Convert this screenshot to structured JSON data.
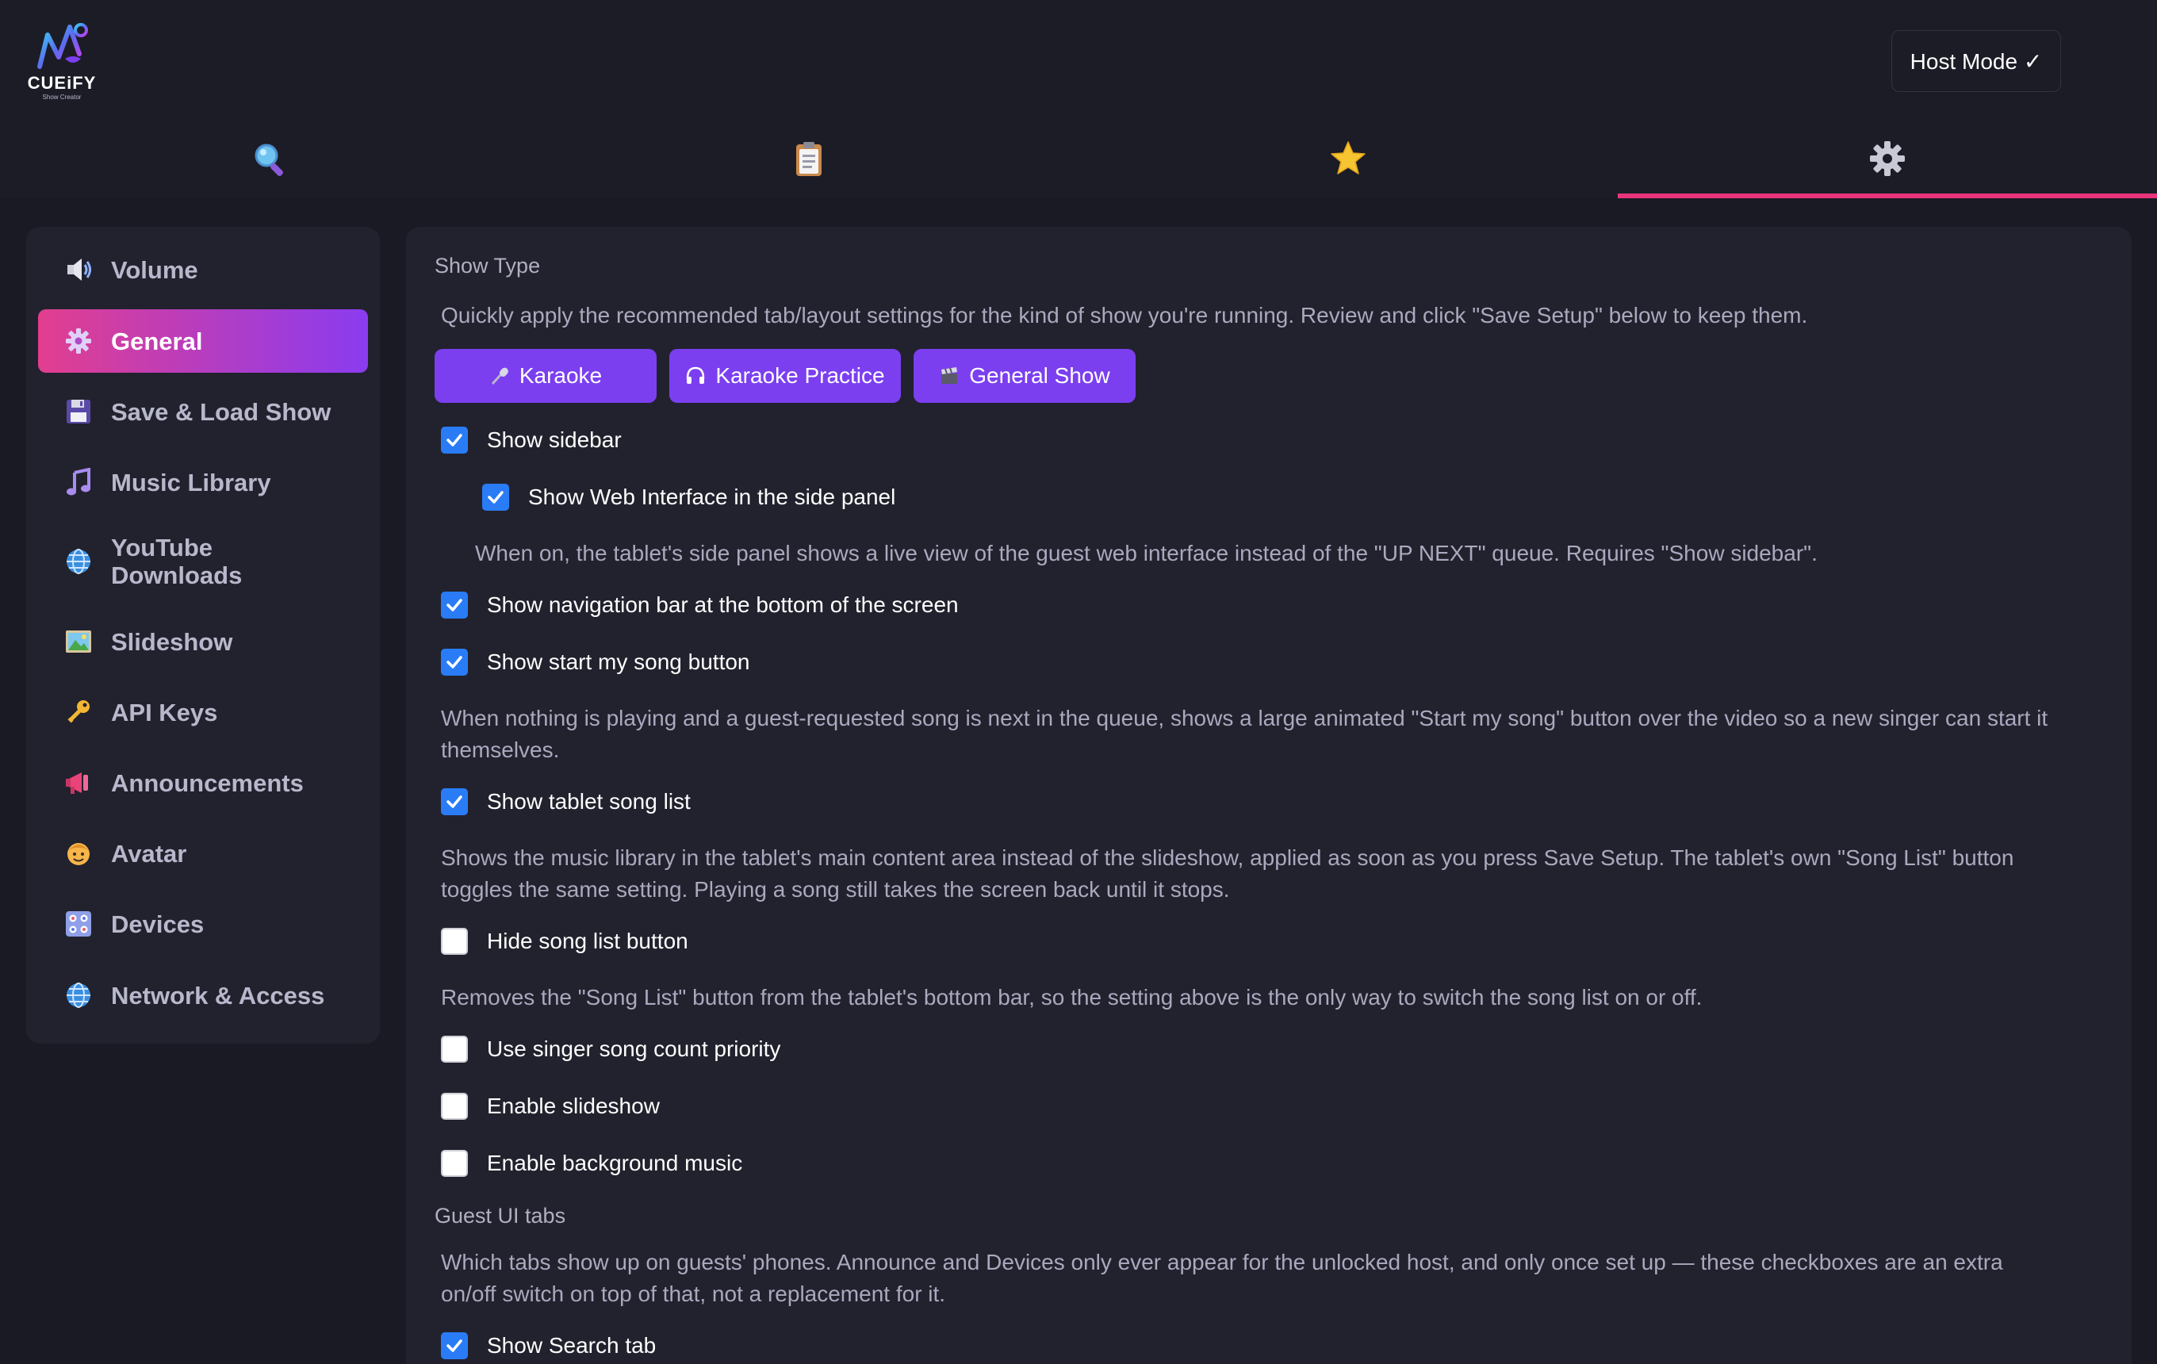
{
  "app": {
    "logo_text": "CUEiFY",
    "logo_sub": "Show Creator",
    "host_mode_label": "Host Mode ✓"
  },
  "tabs": [
    {
      "icon": "search-icon",
      "active": false
    },
    {
      "icon": "clipboard-icon",
      "active": false
    },
    {
      "icon": "star-icon",
      "active": false
    },
    {
      "icon": "gear-icon",
      "active": true
    }
  ],
  "colors": {
    "accent_pink": "#e9357a",
    "accent_purple": "#7b3ff0",
    "checkbox_blue": "#2a7cf6",
    "background": "#1a1a25",
    "panel": "#22222e"
  },
  "sidebar": {
    "items": [
      {
        "label": "Volume",
        "icon": "speaker-icon",
        "active": false
      },
      {
        "label": "General",
        "icon": "gear-icon",
        "active": true
      },
      {
        "label": "Save & Load Show",
        "icon": "floppy-disk-icon",
        "active": false
      },
      {
        "label": "Music Library",
        "icon": "music-note-icon",
        "active": false
      },
      {
        "label": "YouTube Downloads",
        "icon": "globe-icon",
        "active": false
      },
      {
        "label": "Slideshow",
        "icon": "picture-icon",
        "active": false
      },
      {
        "label": "API Keys",
        "icon": "key-icon",
        "active": false
      },
      {
        "label": "Announcements",
        "icon": "megaphone-icon",
        "active": false
      },
      {
        "label": "Avatar",
        "icon": "face-icon",
        "active": false
      },
      {
        "label": "Devices",
        "icon": "control-knobs-icon",
        "active": false
      },
      {
        "label": "Network & Access",
        "icon": "globe-icon",
        "active": false
      }
    ]
  },
  "main": {
    "show_type": {
      "title": "Show Type",
      "description": "Quickly apply the recommended tab/layout settings for the kind of show you're running. Review and click \"Save Setup\" below to keep them.",
      "presets": [
        {
          "label": "Karaoke",
          "icon": "microphone-icon"
        },
        {
          "label": "Karaoke Practice",
          "icon": "headphones-icon"
        },
        {
          "label": "General Show",
          "icon": "clapperboard-icon"
        }
      ]
    },
    "options": {
      "show_sidebar": {
        "label": "Show sidebar",
        "checked": true
      },
      "show_web_interface": {
        "label": "Show Web Interface in the side panel",
        "checked": true
      },
      "web_interface_desc": "When on, the tablet's side panel shows a live view of the guest web interface instead of the \"UP NEXT\" queue. Requires \"Show sidebar\".",
      "show_nav_bar": {
        "label": "Show navigation bar at the bottom of the screen",
        "checked": true
      },
      "show_start_song": {
        "label": "Show start my song button",
        "checked": true
      },
      "start_song_desc_1": "When nothing is playing and a guest-requested song is next in the queue, shows a large animated \"Start my song\" button over the video so a new singer can start it",
      "start_song_desc_2": "themselves.",
      "show_tablet_song_list": {
        "label": "Show tablet song list",
        "checked": true
      },
      "tablet_song_list_desc_1": "Shows the music library in the tablet's main content area instead of the slideshow, applied as soon as you press Save Setup. The tablet's own \"Song List\" button",
      "tablet_song_list_desc_2": "toggles the same setting. Playing a song still takes the screen back until it stops.",
      "hide_song_list_button": {
        "label": "Hide song list button",
        "checked": false
      },
      "hide_song_list_desc": "Removes the \"Song List\" button from the tablet's bottom bar, so the setting above is the only way to switch the song list on or off.",
      "singer_priority": {
        "label": "Use singer song count priority",
        "checked": false
      },
      "enable_slideshow": {
        "label": "Enable slideshow",
        "checked": false
      },
      "enable_bg_music": {
        "label": "Enable background music",
        "checked": false
      }
    },
    "guest_ui_tabs": {
      "title": "Guest UI tabs",
      "description_1": "Which tabs show up on guests' phones. Announce and Devices only ever appear for the unlocked host, and only once set up — these checkboxes are an extra",
      "description_2": "on/off switch on top of that, not a replacement for it.",
      "show_search_tab": {
        "label": "Show Search tab",
        "checked": true
      }
    }
  }
}
